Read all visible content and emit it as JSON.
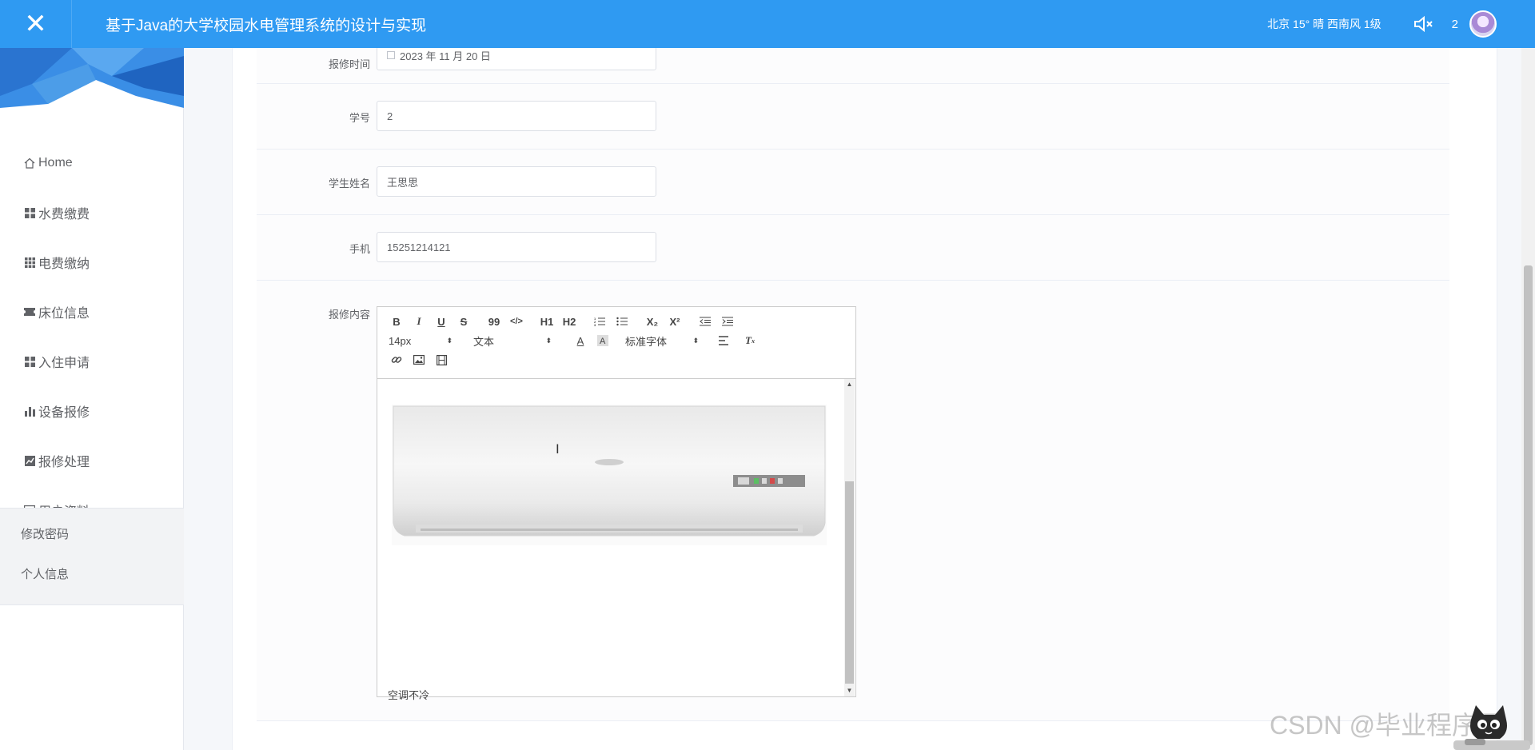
{
  "header": {
    "close_glyph": "✕",
    "title": "基于Java的大学校园水电管理系统的设计与实现",
    "weather": "北京  15°  晴  西南风  1级",
    "notification_count": "2"
  },
  "sidebar": {
    "items": [
      {
        "label": "Home",
        "icon": "home-icon"
      },
      {
        "label": "水费缴费",
        "icon": "grid-icon"
      },
      {
        "label": "电费缴纳",
        "icon": "grid-small-icon"
      },
      {
        "label": "床位信息",
        "icon": "ticket-icon"
      },
      {
        "label": "入住申请",
        "icon": "grid-icon"
      },
      {
        "label": "设备报修",
        "icon": "bar-chart-icon"
      },
      {
        "label": "报修处理",
        "icon": "line-chart-icon"
      },
      {
        "label": "用户资料",
        "icon": "card-icon",
        "expanded": true
      }
    ],
    "subitems": [
      {
        "label": "修改密码"
      },
      {
        "label": "个人信息"
      }
    ]
  },
  "form": {
    "repair_time": {
      "label": "报修时间",
      "value": "2023 年 11 月 20 日"
    },
    "student_id": {
      "label": "学号",
      "value": "2"
    },
    "student_name": {
      "label": "学生姓名",
      "value": "王思思"
    },
    "phone": {
      "label": "手机",
      "value": "15251214121"
    },
    "repair_content": {
      "label": "报修内容",
      "toolbar": {
        "bold": "B",
        "italic": "I",
        "underline": "U",
        "strike": "S",
        "quote": "99",
        "code": "</>",
        "h1": "H1",
        "h2": "H2",
        "sub": "X₂",
        "sup": "X²",
        "size_value": "14px",
        "header_value": "文本",
        "font_value": "标准字体"
      },
      "image": "air-conditioner-image",
      "text": "空调不冷"
    }
  },
  "watermark": "CSDN @毕业程序员"
}
